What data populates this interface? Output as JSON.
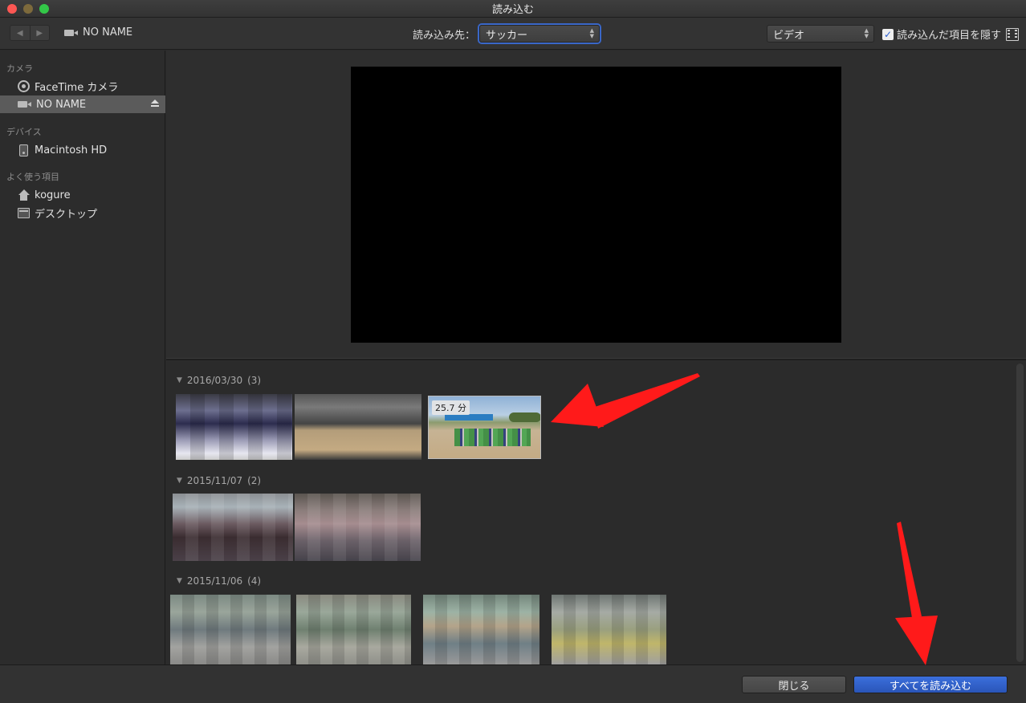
{
  "window": {
    "title": "読み込む"
  },
  "toolbar": {
    "back_glyph": "◀",
    "forward_glyph": "▶",
    "source_name": "NO NAME",
    "destination_label": "読み込み先：",
    "destination_value": "サッカー",
    "filter_value": "ビデオ",
    "hide_imported_label": "読み込んだ項目を隠す",
    "hide_imported_checked": true,
    "check_glyph": "✓",
    "popup_arrows": "▲▼"
  },
  "sidebar": {
    "sections": [
      {
        "heading": "カメラ",
        "items": [
          {
            "label": "FaceTime カメラ",
            "icon": "facetime-camera-icon"
          },
          {
            "label": "NO NAME",
            "icon": "video-camera-icon",
            "selected": true
          }
        ]
      },
      {
        "heading": "デバイス",
        "items": [
          {
            "label": "Macintosh HD",
            "icon": "hard-drive-icon"
          }
        ]
      },
      {
        "heading": "よく使う項目",
        "items": [
          {
            "label": "kogure",
            "icon": "home-icon"
          },
          {
            "label": "デスクトップ",
            "icon": "desktop-icon"
          }
        ]
      }
    ]
  },
  "browser": {
    "disclosure_glyph": "▼",
    "groups": [
      {
        "date": "2016/03/30",
        "count": "(3)",
        "clips": [
          {
            "duration": ""
          },
          {
            "duration": ""
          },
          {
            "duration": "25.7 分"
          }
        ]
      },
      {
        "date": "2015/11/07",
        "count": "(2)"
      },
      {
        "date": "2015/11/06",
        "count": "(4)"
      }
    ]
  },
  "buttons": {
    "close": "閉じる",
    "import_all": "すべてを読み込む"
  },
  "colors": {
    "accent": "#2a5fd4",
    "annotation": "#ff1a1a",
    "window_bg": "#2b2b2b"
  }
}
